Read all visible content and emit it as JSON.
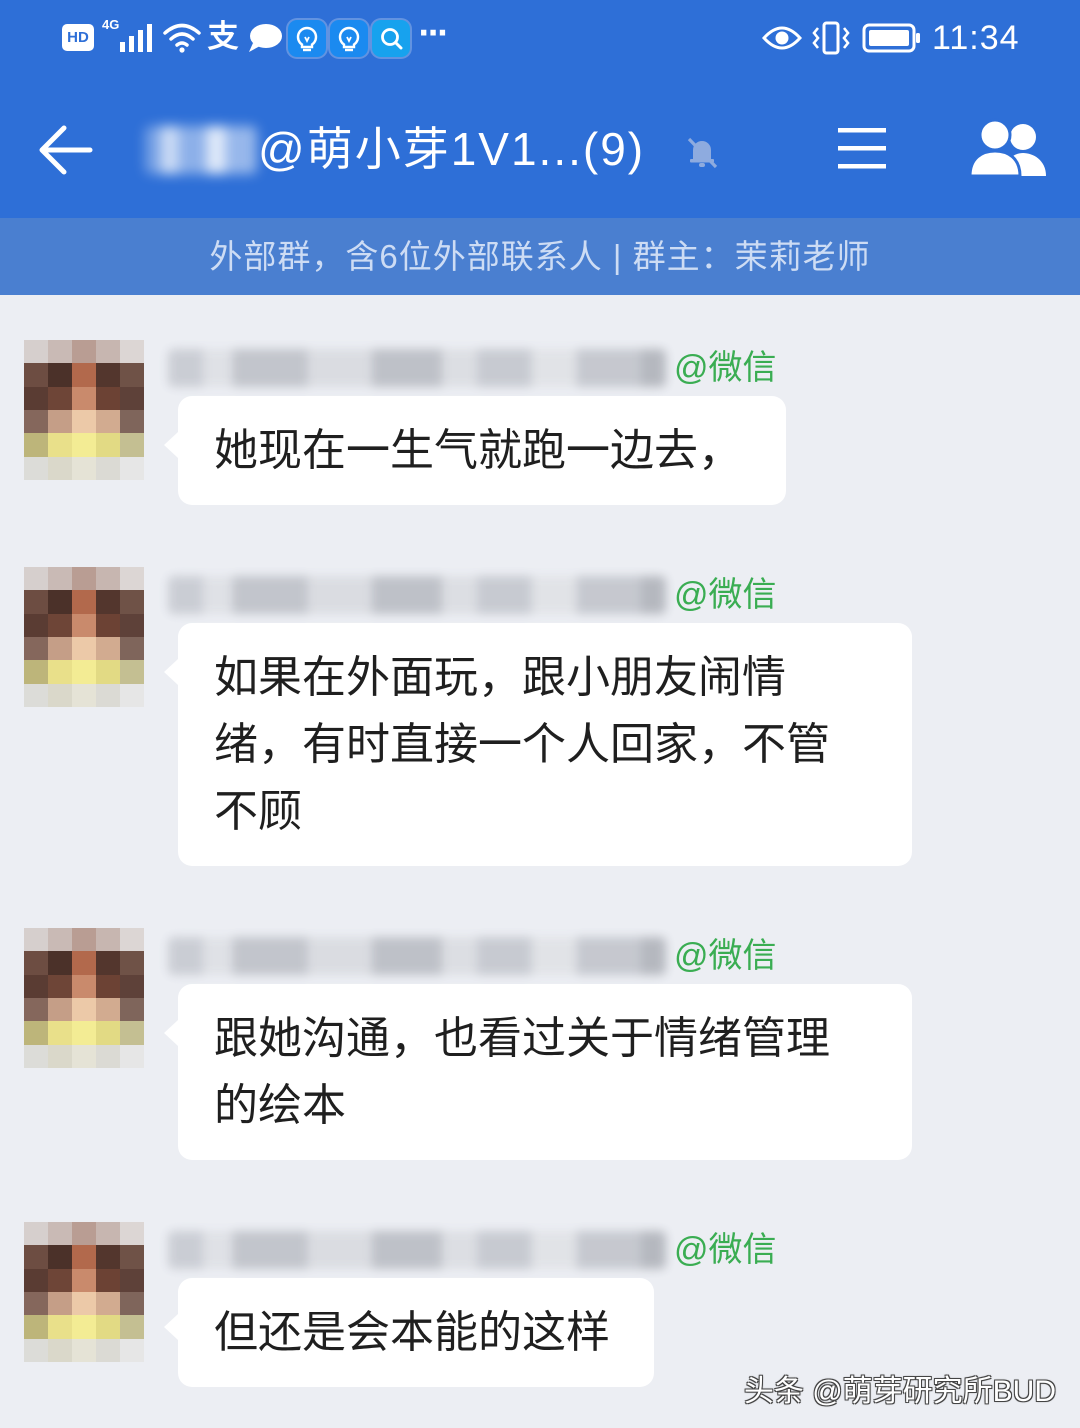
{
  "colors": {
    "header_bg": "#2e6fd7",
    "subheader_bg": "#4a7fd0",
    "subheader_text": "#cddcf4",
    "chat_bg": "#eceef3",
    "bubble_bg": "#ffffff",
    "source_tag": "#3aad52"
  },
  "status_bar": {
    "hd_label": "HD",
    "network_label": "4G",
    "alipay_glyph": "支",
    "more_label": "···",
    "time": "11:34",
    "icons": [
      "hd-voice-badge",
      "cellular-signal-icon",
      "wifi-icon",
      "alipay-icon",
      "chat-notification-icon",
      "lightbulb-app-icon",
      "lightbulb-app-icon",
      "search-app-icon",
      "more-notifications-icon",
      "eye-comfort-icon",
      "vibrate-icon",
      "battery-icon"
    ]
  },
  "header": {
    "title": "@萌小芽1V1...(9)",
    "muted": true,
    "icons": [
      "back-arrow-icon",
      "mute-bell-icon",
      "menu-icon",
      "group-members-icon"
    ]
  },
  "group_info": "外部群，含6位外部联系人 | 群主：茉莉老师",
  "messages": [
    {
      "source_tag": "@微信",
      "lines": [
        "她现在一生气就跑一边去，"
      ]
    },
    {
      "source_tag": "@微信",
      "lines": [
        "如果在外面玩，跟小朋友闹情",
        "绪，有时直接一个人回家，不管",
        "不顾"
      ]
    },
    {
      "source_tag": "@微信",
      "lines": [
        "跟她沟通，也看过关于情绪管理",
        "的绘本"
      ]
    },
    {
      "source_tag": "@微信",
      "lines": [
        "但还是会本能的这样"
      ]
    }
  ],
  "watermark": "头条 @萌芽研究所BUD"
}
